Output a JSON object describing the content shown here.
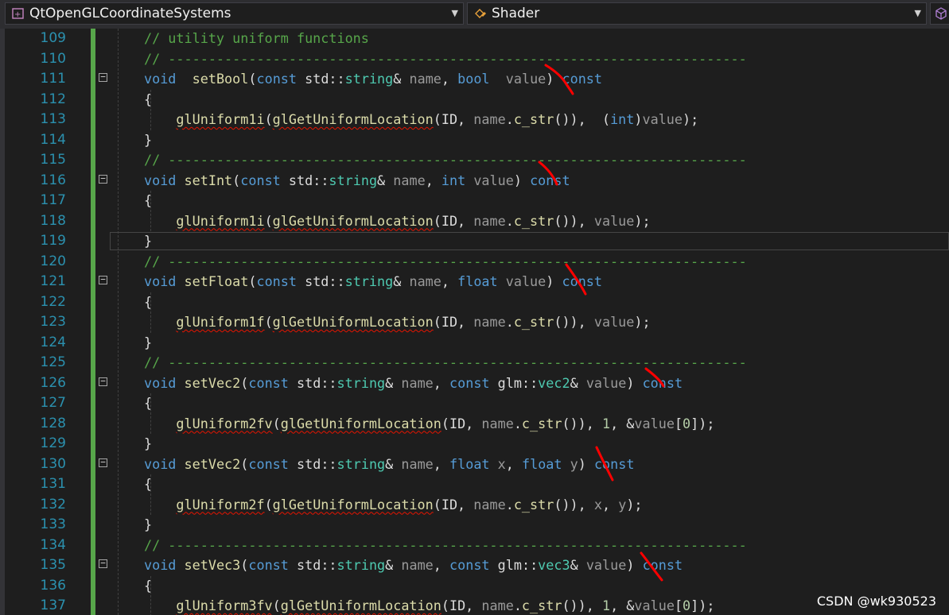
{
  "toolbar": {
    "project_label": "QtOpenGLCoordinateSystems",
    "scope_label": "Shader"
  },
  "editor": {
    "lines": [
      {
        "n": "109",
        "tokens": [
          [
            "cm",
            "// utility uniform functions"
          ]
        ]
      },
      {
        "n": "110",
        "tokens": [
          [
            "cm",
            "// ------------------------------------------------------------------------"
          ]
        ]
      },
      {
        "n": "111",
        "fold": true,
        "tokens": [
          [
            "kw",
            "void"
          ],
          [
            "",
            "  "
          ],
          [
            "fn",
            "setBool"
          ],
          [
            "",
            "("
          ],
          [
            "kw",
            "const"
          ],
          [
            "",
            " std::"
          ],
          [
            "ty",
            "string"
          ],
          [
            "",
            "& "
          ],
          [
            "pm",
            "name"
          ],
          [
            "",
            ", "
          ],
          [
            "kw",
            "bool"
          ],
          [
            "",
            "",
            " "
          ],
          [
            "pm",
            " value"
          ],
          [
            "",
            ") "
          ],
          [
            "kw",
            "const"
          ]
        ]
      },
      {
        "n": "112",
        "tokens": [
          [
            "",
            "{"
          ]
        ]
      },
      {
        "n": "113",
        "tokens": [
          [
            "",
            "    "
          ],
          [
            "fnsq",
            "glUniform1i"
          ],
          [
            "",
            "("
          ],
          [
            "fnsq",
            "glGetUniformLocation"
          ],
          [
            "",
            "(ID, "
          ],
          [
            "pm",
            "name"
          ],
          [
            "",
            "."
          ],
          [
            "fn",
            "c_str"
          ],
          [
            "",
            "()),  ("
          ],
          [
            "kw",
            "int"
          ],
          [
            "",
            ")"
          ],
          [
            "pm",
            "value"
          ],
          [
            "",
            ");"
          ]
        ]
      },
      {
        "n": "114",
        "tokens": [
          [
            "",
            "}"
          ]
        ]
      },
      {
        "n": "115",
        "tokens": [
          [
            "cm",
            "// ------------------------------------------------------------------------"
          ]
        ]
      },
      {
        "n": "116",
        "fold": true,
        "tokens": [
          [
            "kw",
            "void"
          ],
          [
            "",
            " "
          ],
          [
            "fn",
            "setInt"
          ],
          [
            "",
            "("
          ],
          [
            "kw",
            "const"
          ],
          [
            "",
            " std::"
          ],
          [
            "ty",
            "string"
          ],
          [
            "",
            "& "
          ],
          [
            "pm",
            "name"
          ],
          [
            "",
            ", "
          ],
          [
            "kw",
            "int"
          ],
          [
            "pm",
            " value"
          ],
          [
            "",
            ") "
          ],
          [
            "kw",
            "const"
          ]
        ]
      },
      {
        "n": "117",
        "tokens": [
          [
            "",
            "{"
          ]
        ]
      },
      {
        "n": "118",
        "tokens": [
          [
            "",
            "    "
          ],
          [
            "fnsq",
            "glUniform1i"
          ],
          [
            "",
            "("
          ],
          [
            "fnsq",
            "glGetUniformLocation"
          ],
          [
            "",
            "(ID, "
          ],
          [
            "pm",
            "name"
          ],
          [
            "",
            "."
          ],
          [
            "fn",
            "c_str"
          ],
          [
            "",
            "()), "
          ],
          [
            "pm",
            "value"
          ],
          [
            "",
            ");"
          ]
        ]
      },
      {
        "n": "119",
        "tokens": [
          [
            "",
            "}"
          ]
        ]
      },
      {
        "n": "120",
        "tokens": [
          [
            "cm",
            "// ------------------------------------------------------------------------"
          ]
        ]
      },
      {
        "n": "121",
        "fold": true,
        "tokens": [
          [
            "kw",
            "void"
          ],
          [
            "",
            " "
          ],
          [
            "fn",
            "setFloat"
          ],
          [
            "",
            "("
          ],
          [
            "kw",
            "const"
          ],
          [
            "",
            " std::"
          ],
          [
            "ty",
            "string"
          ],
          [
            "",
            "& "
          ],
          [
            "pm",
            "name"
          ],
          [
            "",
            ", "
          ],
          [
            "kw",
            "float"
          ],
          [
            "pm",
            " value"
          ],
          [
            "",
            ") "
          ],
          [
            "kw",
            "const"
          ]
        ]
      },
      {
        "n": "122",
        "tokens": [
          [
            "",
            "{"
          ]
        ]
      },
      {
        "n": "123",
        "tokens": [
          [
            "",
            "    "
          ],
          [
            "fnsq",
            "glUniform1f"
          ],
          [
            "",
            "("
          ],
          [
            "fnsq",
            "glGetUniformLocation"
          ],
          [
            "",
            "(ID, "
          ],
          [
            "pm",
            "name"
          ],
          [
            "",
            "."
          ],
          [
            "fn",
            "c_str"
          ],
          [
            "",
            "()), "
          ],
          [
            "pm",
            "value"
          ],
          [
            "",
            ");"
          ]
        ]
      },
      {
        "n": "124",
        "tokens": [
          [
            "",
            "}"
          ]
        ]
      },
      {
        "n": "125",
        "tokens": [
          [
            "cm",
            "// ------------------------------------------------------------------------"
          ]
        ]
      },
      {
        "n": "126",
        "fold": true,
        "tokens": [
          [
            "kw",
            "void"
          ],
          [
            "",
            " "
          ],
          [
            "fn",
            "setVec2"
          ],
          [
            "",
            "("
          ],
          [
            "kw",
            "const"
          ],
          [
            "",
            " std::"
          ],
          [
            "ty",
            "string"
          ],
          [
            "",
            "& "
          ],
          [
            "pm",
            "name"
          ],
          [
            "",
            ", "
          ],
          [
            "kw",
            "const"
          ],
          [
            "",
            " glm::"
          ],
          [
            "ty",
            "vec2"
          ],
          [
            "",
            "& "
          ],
          [
            "pm",
            "value"
          ],
          [
            "",
            ") "
          ],
          [
            "kw",
            "const"
          ]
        ]
      },
      {
        "n": "127",
        "tokens": [
          [
            "",
            "{"
          ]
        ]
      },
      {
        "n": "128",
        "tokens": [
          [
            "",
            "    "
          ],
          [
            "fnsq",
            "glUniform2fv"
          ],
          [
            "",
            "("
          ],
          [
            "fnsq",
            "glGetUniformLocation"
          ],
          [
            "",
            "(ID, "
          ],
          [
            "pm",
            "name"
          ],
          [
            "",
            "."
          ],
          [
            "fn",
            "c_str"
          ],
          [
            "",
            "()), "
          ],
          [
            "nm",
            "1"
          ],
          [
            "",
            ", &"
          ],
          [
            "pm",
            "value"
          ],
          [
            "",
            "["
          ],
          [
            "nm",
            "0"
          ],
          [
            "",
            "]);"
          ]
        ]
      },
      {
        "n": "129",
        "tokens": [
          [
            "",
            "}"
          ]
        ]
      },
      {
        "n": "130",
        "fold": true,
        "tokens": [
          [
            "kw",
            "void"
          ],
          [
            "",
            " "
          ],
          [
            "fn",
            "setVec2"
          ],
          [
            "",
            "("
          ],
          [
            "kw",
            "const"
          ],
          [
            "",
            " std::"
          ],
          [
            "ty",
            "string"
          ],
          [
            "",
            "& "
          ],
          [
            "pm",
            "name"
          ],
          [
            "",
            ", "
          ],
          [
            "kw",
            "float"
          ],
          [
            "pm",
            " x"
          ],
          [
            "",
            ", "
          ],
          [
            "kw",
            "float"
          ],
          [
            "pm",
            " y"
          ],
          [
            "",
            ") "
          ],
          [
            "kw",
            "const"
          ]
        ]
      },
      {
        "n": "131",
        "tokens": [
          [
            "",
            "{"
          ]
        ]
      },
      {
        "n": "132",
        "tokens": [
          [
            "",
            "    "
          ],
          [
            "fnsq",
            "glUniform2f"
          ],
          [
            "",
            "("
          ],
          [
            "fnsq",
            "glGetUniformLocation"
          ],
          [
            "",
            "(ID, "
          ],
          [
            "pm",
            "name"
          ],
          [
            "",
            "."
          ],
          [
            "fn",
            "c_str"
          ],
          [
            "",
            "()), "
          ],
          [
            "pm",
            "x"
          ],
          [
            "",
            ", "
          ],
          [
            "pm",
            "y"
          ],
          [
            "",
            ");"
          ]
        ]
      },
      {
        "n": "133",
        "tokens": [
          [
            "",
            "}"
          ]
        ]
      },
      {
        "n": "134",
        "tokens": [
          [
            "cm",
            "// ------------------------------------------------------------------------"
          ]
        ]
      },
      {
        "n": "135",
        "fold": true,
        "tokens": [
          [
            "kw",
            "void"
          ],
          [
            "",
            " "
          ],
          [
            "fn",
            "setVec3"
          ],
          [
            "",
            "("
          ],
          [
            "kw",
            "const"
          ],
          [
            "",
            " std::"
          ],
          [
            "ty",
            "string"
          ],
          [
            "",
            "& "
          ],
          [
            "pm",
            "name"
          ],
          [
            "",
            ", "
          ],
          [
            "kw",
            "const"
          ],
          [
            "",
            " glm::"
          ],
          [
            "ty",
            "vec3"
          ],
          [
            "",
            "& "
          ],
          [
            "pm",
            "value"
          ],
          [
            "",
            ") "
          ],
          [
            "kw",
            "const"
          ]
        ]
      },
      {
        "n": "136",
        "tokens": [
          [
            "",
            "{"
          ]
        ]
      },
      {
        "n": "137",
        "tokens": [
          [
            "",
            "    "
          ],
          [
            "fnsq",
            "glUniform3fv"
          ],
          [
            "",
            "("
          ],
          [
            "fnsq",
            "glGetUniformLocation"
          ],
          [
            "",
            "(ID, "
          ],
          [
            "pm",
            "name"
          ],
          [
            "",
            "."
          ],
          [
            "fn",
            "c_str"
          ],
          [
            "",
            "()), "
          ],
          [
            "nm",
            "1"
          ],
          [
            "",
            ", &"
          ],
          [
            "pm",
            "value"
          ],
          [
            "",
            "["
          ],
          [
            "nm",
            "0"
          ],
          [
            "",
            "]);"
          ]
        ]
      }
    ]
  },
  "watermark": "CSDN @wk930523"
}
